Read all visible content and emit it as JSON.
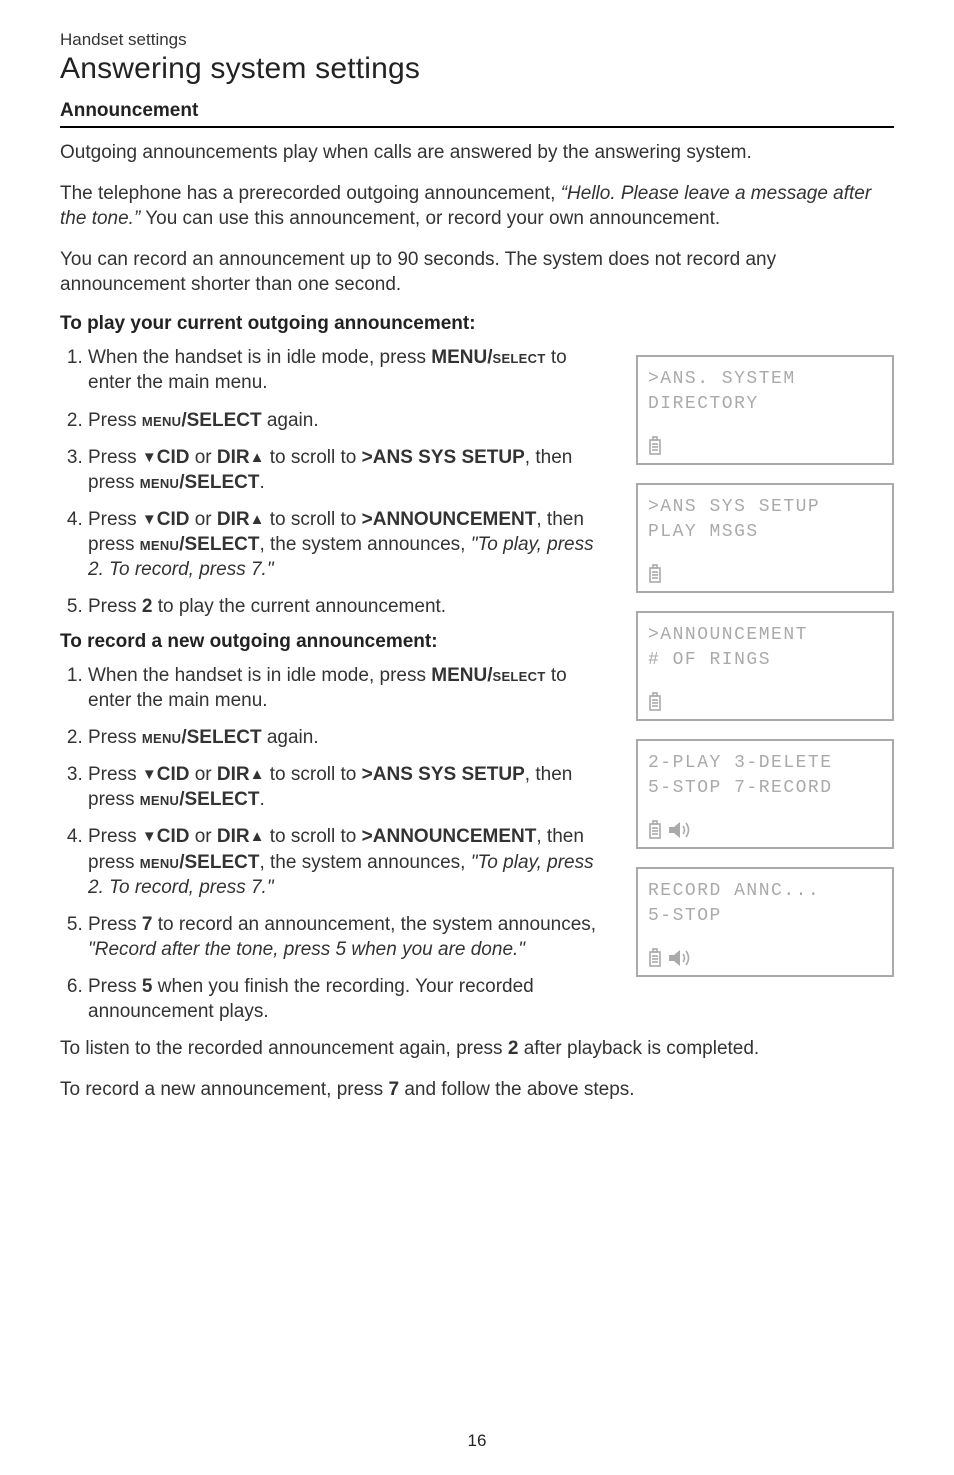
{
  "breadcrumb": "Handset settings",
  "page_title": "Answering system settings",
  "section_heading": "Announcement",
  "para1": "Outgoing announcements play when calls are answered by the answering system.",
  "para2_a": "The telephone has a prerecorded outgoing announcement, ",
  "para2_quote": "“Hello. Please leave a message after the tone.”",
  "para2_b": " You can use this announcement, or record your own announcement.",
  "para3": "You can record an announcement up to 90 seconds. The system does not record any announcement shorter than one second.",
  "subheading_play": "To play your current outgoing announcement:",
  "subheading_record": "To record a new outgoing announcement:",
  "labels": {
    "menu_select_u": "MENU/",
    "menu_select_l": "select",
    "menu_select_alt_l": "menu",
    "select_u": "/SELECT",
    "cid": "CID",
    "dir": "DIR",
    "ans_setup": ">ANS SYS SETUP",
    "announcement": ">ANNOUNCEMENT",
    "two": "2",
    "seven": "7",
    "five": "5"
  },
  "play_steps": {
    "s1_a": "When the handset is in idle mode, press ",
    "s1_b": " to enter the main menu.",
    "s2_a": "Press ",
    "s2_b": " again.",
    "s3_a": "Press ",
    "s3_b": " or ",
    "s3_c": " to scroll to ",
    "s3_d": ", then press ",
    "s3_e": ".",
    "s4_a": "Press ",
    "s4_b": " or ",
    "s4_c": " to scroll to ",
    "s4_d": ", then press ",
    "s4_e": ", the system announces, ",
    "s4_quote": "\"To play, press 2. To record, press 7.\"",
    "s5_a": "Press ",
    "s5_b": " to play the current announcement."
  },
  "record_steps": {
    "s1_a": "When the handset is in idle mode, press ",
    "s1_b": " to enter the main menu.",
    "s2_a": "Press ",
    "s2_b": " again.",
    "s3_a": "Press ",
    "s3_b": " or ",
    "s3_c": " to scroll to ",
    "s3_d": ", then press ",
    "s3_e": ".",
    "s4_a": "Press ",
    "s4_b": " or ",
    "s4_c": " to scroll to ",
    "s4_d": ", then press ",
    "s4_e": ", the system announces, ",
    "s4_quote": "\"To play, press 2. To record, press 7.\"",
    "s5_a": "Press ",
    "s5_b": " to record an announcement, the system announces, ",
    "s5_quote": "\"Record after the tone, press 5 when you are done.\"",
    "s6_a": "Press ",
    "s6_b": " when you finish the recording. Your recorded announcement plays."
  },
  "footer1_a": "To listen to the recorded announcement again, press ",
  "footer1_b": " after playback is completed.",
  "footer2_a": "To record a new announcement, press ",
  "footer2_b": " and follow the above steps.",
  "page_number": "16",
  "screens": {
    "s1": {
      "l1": ">ANS. SYSTEM",
      "l2": " DIRECTORY"
    },
    "s2": {
      "l1": ">ANS SYS SETUP",
      "l2": " PLAY MSGS"
    },
    "s3": {
      "l1": ">ANNOUNCEMENT",
      "l2": " # OF RINGS"
    },
    "s4": {
      "l1": "2-PLAY 3-DELETE",
      "l2": "5-STOP 7-RECORD"
    },
    "s5": {
      "l1": "RECORD ANNC...",
      "l2": "5-STOP"
    }
  }
}
